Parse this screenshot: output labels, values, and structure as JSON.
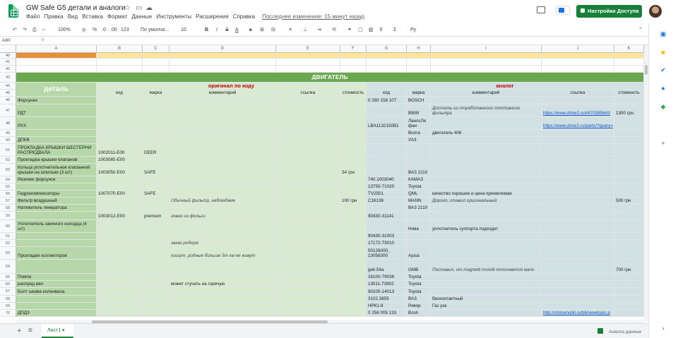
{
  "title": "GW Safe G5 детали и аналоги",
  "menu": [
    "Файл",
    "Правка",
    "Вид",
    "Вставка",
    "Формат",
    "Данные",
    "Инструменты",
    "Расширения",
    "Справка"
  ],
  "last_edit": "Последнее изменение: 15 минут назад",
  "share": "Настройки Доступа",
  "toolbar": {
    "zoom": "100%",
    "rub": "р.",
    "pct": "%",
    "dec0": ".0",
    "dec00": ".00",
    "fmt": "123",
    "font": "По умолча...",
    "size": "10",
    "bold": "B",
    "italic": "I",
    "strike": "S",
    "color": "A"
  },
  "namebox": "A80",
  "fx": "fx",
  "columns": [
    {
      "id": "A",
      "w": 114
    },
    {
      "id": "B",
      "w": 65
    },
    {
      "id": "C",
      "w": 38
    },
    {
      "id": "D",
      "w": 151
    },
    {
      "id": "E",
      "w": 91
    },
    {
      "id": "F",
      "w": 37
    },
    {
      "id": "G",
      "w": 57
    },
    {
      "id": "H",
      "w": 34
    },
    {
      "id": "I",
      "w": 157
    },
    {
      "id": "J",
      "w": 103
    },
    {
      "id": "K",
      "w": 42
    }
  ],
  "section_title": "ДВИГАТЕЛЬ",
  "header": {
    "detail": "деталь",
    "original": "оригинал по коду",
    "analog": "аналог",
    "sub": [
      "код",
      "марка",
      "комментарий",
      "ссылка",
      "стоимость",
      "код",
      "марка",
      "комментарий",
      "ссылка",
      "стоимость"
    ]
  },
  "rows": [
    {
      "n": "46",
      "h": 11,
      "c": [
        "Форсунки",
        "",
        "",
        "",
        "",
        "",
        "0 280 158 107",
        "BOSCH",
        "",
        "",
        ""
      ]
    },
    {
      "n": "47",
      "h": 18,
      "c": [
        "РДТ",
        "",
        "",
        "",
        "",
        "",
        "",
        "BMW",
        "Достать из отработанного топливного фильтра",
        "https://www.drive2.ru/l/470385643",
        "1300 грн"
      ]
    },
    {
      "n": "48",
      "h": 18,
      "c": [
        "РХХ",
        "",
        "",
        "",
        "",
        "",
        "LBA1132150B1",
        "ЛаносЛе фан",
        "",
        "https://www.drive2.ru/parts/?query=",
        ""
      ]
    },
    {
      "n": "49",
      "h": 10,
      "c": [
        "",
        "",
        "",
        "",
        "",
        "",
        "",
        "Волга",
        "двигатель 406",
        "",
        ""
      ]
    },
    {
      "n": "50",
      "h": 10,
      "c": [
        "ДПКВ",
        "",
        "",
        "",
        "",
        "",
        "",
        "УАЗ",
        "",
        "",
        ""
      ]
    },
    {
      "n": "51",
      "h": 18,
      "c": [
        "ПРОКЛАДКА КРЫШКИ ШЕСТЕРНИ РАСПРЕДВАЛА",
        "1002011-E00",
        "DEER",
        "",
        "",
        "",
        "",
        "",
        "",
        "",
        ""
      ]
    },
    {
      "n": "52",
      "h": 10,
      "c": [
        "Прокладка крышки клапанов",
        "1003085-E00",
        "",
        "",
        "",
        "",
        "",
        "",
        "",
        "",
        ""
      ]
    },
    {
      "n": "53",
      "h": 18,
      "c": [
        "Кольца уплотнительное клапанной крышки на шпильки (3 шт)",
        "1003050-E00",
        "SAFE",
        "",
        "",
        "34 грн",
        "",
        "ВАЗ 2110",
        "",
        "",
        ""
      ]
    },
    {
      "n": "54",
      "h": 10,
      "c": [
        "Резинки форсунок",
        "",
        "",
        "",
        "",
        "",
        "740.1003040",
        "КАМАЗ",
        "",
        "",
        ""
      ]
    },
    {
      "n": "55",
      "h": 10,
      "c": [
        "",
        "",
        "",
        "",
        "",
        "",
        "13750-71020",
        "Toyota",
        "",
        "",
        ""
      ]
    },
    {
      "n": "56",
      "h": 10,
      "c": [
        "Гидрокомпенсаторы",
        "1007070-E00",
        "SAFE",
        "",
        "",
        "",
        "TV2501",
        "QML",
        "качество хорошее и цена приемлемая",
        "",
        ""
      ]
    },
    {
      "n": "57",
      "h": 10,
      "c": [
        "Фильтр воздушный",
        "",
        "",
        "Обычный фильтр, наблюдаем",
        "",
        "100 грн",
        "C16136",
        "MANN",
        "Дорого, ставил оригинальный",
        "",
        "500 грн"
      ]
    },
    {
      "n": "58",
      "h": 10,
      "c": [
        "Натяжитель генератора",
        "",
        "",
        "",
        "",
        "",
        "",
        "ВАЗ 2110",
        "",
        "",
        ""
      ]
    },
    {
      "n": "59",
      "h": 12,
      "c": [
        "",
        "1003012-E00",
        "premium",
        "говно из фольги",
        "",
        "",
        "90430-31141",
        "",
        "",
        "",
        ""
      ]
    },
    {
      "n": "60",
      "h": 18,
      "c": [
        "Уплотнитель свечного колодца (4 шт)",
        "",
        "",
        "",
        "",
        "",
        "",
        "Нива",
        "уплотнитель суппорта подходит",
        "",
        ""
      ]
    },
    {
      "n": "61",
      "h": 10,
      "c": [
        "",
        "",
        "",
        "",
        "",
        "",
        "90430-31003",
        "",
        "",
        "",
        ""
      ]
    },
    {
      "n": "62",
      "h": 10,
      "c": [
        "",
        "",
        "",
        "заказ родную",
        "",
        "",
        "17172-73010",
        "",
        "",
        "",
        ""
      ]
    },
    {
      "n": "63",
      "h": 18,
      "c": [
        "Прокладки коллекторов",
        "",
        "",
        "пишут, родные больше 5т км не живут",
        "",
        "",
        "50126000, 13058300",
        "Ajusa",
        "",
        "",
        ""
      ]
    },
    {
      "n": "64",
      "h": 20,
      "c": [
        "",
        "",
        "",
        "",
        "",
        "",
        "gwt-54a",
        "GMB",
        "Поставил, от magnetti morelli отличается мало",
        "",
        "700 грн"
      ]
    },
    {
      "n": "65",
      "h": 10,
      "c": [
        "Помпа",
        "",
        "",
        "",
        "",
        "",
        "16100-79036",
        "Toyota",
        "",
        "",
        ""
      ]
    },
    {
      "n": "66",
      "h": 10,
      "c": [
        "распред вал",
        "",
        "",
        "может стучать на горячую",
        "",
        "",
        "13511-73902",
        "Toyota",
        "",
        "",
        ""
      ]
    },
    {
      "n": "67",
      "h": 11,
      "c": [
        "Болт шкива коленвала",
        "",
        "",
        "",
        "",
        "",
        "90105-14013",
        "Toyota",
        "",
        "",
        ""
      ]
    },
    {
      "n": "68",
      "h": 10,
      "c": [
        "",
        "",
        "",
        "",
        "",
        "",
        "3102.3855",
        "ВАЗ",
        "бесконтактный",
        "",
        ""
      ]
    },
    {
      "n": "69",
      "h": 10,
      "c": [
        "",
        "",
        "",
        "",
        "",
        "",
        "НРК1-8",
        "Рикор",
        "Газ уаз",
        "",
        ""
      ]
    },
    {
      "n": "70",
      "h": 10,
      "c": [
        "ДПДЗ",
        "",
        "",
        "",
        "",
        "",
        "0 258 005 133",
        "Bosh",
        "",
        "http://chinamobil.ru/bb/viewtopic.p",
        ""
      ]
    }
  ],
  "sheet": "Лист1",
  "explore": "Анализ данных"
}
